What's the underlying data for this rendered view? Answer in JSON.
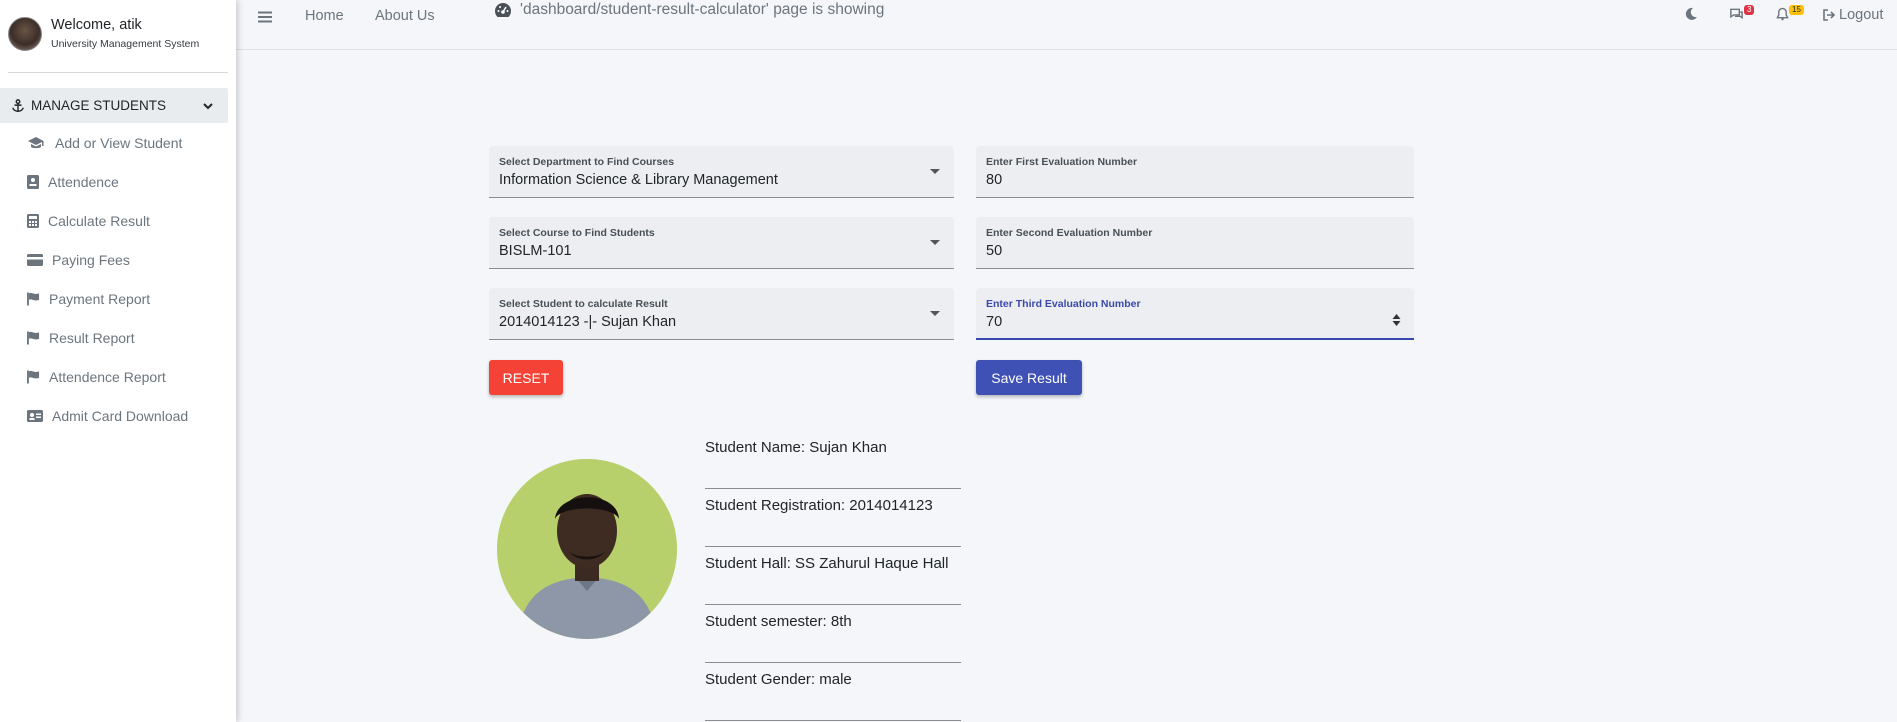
{
  "user": {
    "welcome": "Welcome, atik",
    "system": "University Management System"
  },
  "sidebar": {
    "section": "MANAGE STUDENTS",
    "items": [
      {
        "label": "Add or View Student",
        "icon": "graduation-cap-icon"
      },
      {
        "label": "Attendence",
        "icon": "id-badge-icon"
      },
      {
        "label": "Calculate Result",
        "icon": "calculator-icon"
      },
      {
        "label": "Paying Fees",
        "icon": "credit-card-icon"
      },
      {
        "label": "Payment Report",
        "icon": "flag-icon"
      },
      {
        "label": "Result Report",
        "icon": "flag-icon"
      },
      {
        "label": "Attendence Report",
        "icon": "flag-icon"
      },
      {
        "label": "Admit Card Download",
        "icon": "id-card-icon"
      }
    ]
  },
  "navbar": {
    "home": "Home",
    "about": "About Us",
    "page_message": "'dashboard/student-result-calculator' page is showing",
    "messages_count": "3",
    "notifications_count": "15",
    "logout": "Logout"
  },
  "form": {
    "department": {
      "label": "Select Department to Find Courses",
      "value": "Information Science & Library Management"
    },
    "course": {
      "label": "Select Course to Find Students",
      "value": "BISLM-101"
    },
    "student": {
      "label": "Select Student to calculate Result",
      "value": "2014014123 -|- Sujan Khan"
    },
    "first_eval": {
      "label": "Enter First Evaluation Number",
      "value": "80"
    },
    "second_eval": {
      "label": "Enter Second Evaluation Number",
      "value": "50"
    },
    "third_eval": {
      "label": "Enter Third Evaluation Number",
      "value": "70"
    },
    "reset_label": "RESET",
    "save_label": "Save Result"
  },
  "student_info": {
    "name": "Student Name: Sujan Khan",
    "registration": "Student Registration: 2014014123",
    "hall": "Student Hall: SS Zahurul Haque Hall",
    "semester": "Student semester: 8th",
    "gender": "Student Gender: male"
  },
  "colors": {
    "reset": "#f44336",
    "save": "#3f51b5",
    "focus": "#3949ab",
    "message_badge": "#dc3545",
    "notification_badge": "#ffc107"
  }
}
